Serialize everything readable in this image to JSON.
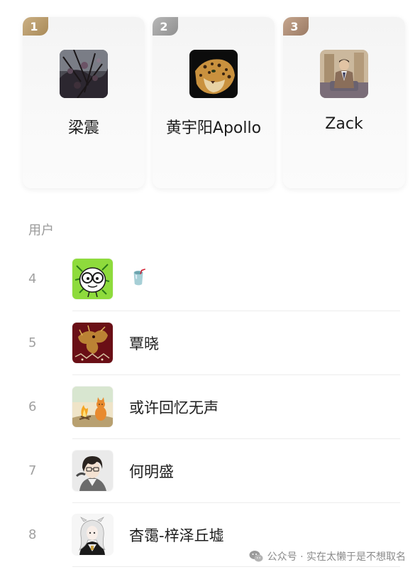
{
  "top_ranks": [
    {
      "rank": "1",
      "name": "梁震",
      "avatar": "tree-branches-photo"
    },
    {
      "rank": "2",
      "name": "黄宇阳Apollo",
      "avatar": "leopard-photo"
    },
    {
      "rank": "3",
      "name": "Zack",
      "avatar": "man-in-suit-photo"
    }
  ],
  "section": {
    "label": "用户"
  },
  "users": [
    {
      "rank": "4",
      "name": "🥤",
      "avatar": "cartoon-glasses-face"
    },
    {
      "rank": "5",
      "name": "覃晓",
      "avatar": "red-dragon-art"
    },
    {
      "rank": "6",
      "name": "或许回忆无声",
      "avatar": "campfire-cat-illustration"
    },
    {
      "rank": "7",
      "name": "何明盛",
      "avatar": "anime-boy-portrait"
    },
    {
      "rank": "8",
      "name": "杳霭-梓泽丘墟",
      "avatar": "white-hair-anime-character"
    }
  ],
  "watermark": {
    "text": "公众号 · 实在太懒于是不想取名",
    "icon": "wechat-icon"
  },
  "colors": {
    "gold": "#b8996a",
    "silver": "#a3a3a3",
    "bronze": "#b08e76",
    "muted_text": "#9a9a9a"
  }
}
